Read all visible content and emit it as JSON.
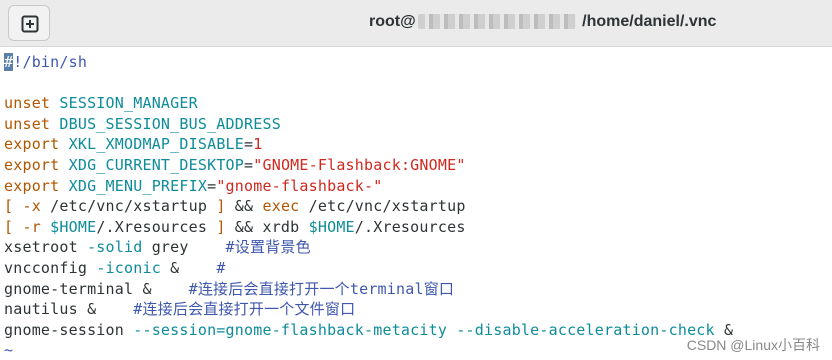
{
  "titlebar": {
    "new_tab_icon": "new-tab-icon",
    "title_prefix": "root@",
    "title_suffix": " /home/daniel/.vnc"
  },
  "colors": {
    "keyword": "#0e8c9a",
    "builtin": "#b25600",
    "string": "#d0281e",
    "comment": "#3f58ae",
    "text": "#2e3436",
    "cursor": "#5a7fa8"
  },
  "editor": {
    "lines": [
      [
        {
          "t": "#",
          "c": "cursor"
        },
        {
          "t": "!/bin/sh",
          "c": "cmt-blue"
        }
      ],
      [],
      [
        {
          "t": "unset",
          "c": "kw-brown"
        },
        {
          "t": " SESSION_MANAGER",
          "c": "kw-cyan"
        }
      ],
      [
        {
          "t": "unset",
          "c": "kw-brown"
        },
        {
          "t": " DBUS_SESSION_BUS_ADDRESS",
          "c": "kw-cyan"
        }
      ],
      [
        {
          "t": "export",
          "c": "kw-brown"
        },
        {
          "t": " XKL_XMODMAP_DISABLE",
          "c": "kw-cyan"
        },
        {
          "t": "=",
          "c": "plain"
        },
        {
          "t": "1",
          "c": "str-red"
        }
      ],
      [
        {
          "t": "export",
          "c": "kw-brown"
        },
        {
          "t": " XDG_CURRENT_DESKTOP",
          "c": "kw-cyan"
        },
        {
          "t": "=",
          "c": "plain"
        },
        {
          "t": "\"GNOME-Flashback:GNOME\"",
          "c": "str-red"
        }
      ],
      [
        {
          "t": "export",
          "c": "kw-brown"
        },
        {
          "t": " XDG_MENU_PREFIX",
          "c": "kw-cyan"
        },
        {
          "t": "=",
          "c": "plain"
        },
        {
          "t": "\"gnome-flashback-\"",
          "c": "str-red"
        }
      ],
      [
        {
          "t": "[ -x ",
          "c": "kw-brown"
        },
        {
          "t": "/etc/vnc/xstartup ",
          "c": "plain"
        },
        {
          "t": "]",
          "c": "kw-brown"
        },
        {
          "t": " && ",
          "c": "plain"
        },
        {
          "t": "exec",
          "c": "kw-brown"
        },
        {
          "t": " /etc/vnc/xstartup",
          "c": "plain"
        }
      ],
      [
        {
          "t": "[ -r ",
          "c": "kw-brown"
        },
        {
          "t": "$HOME",
          "c": "kw-cyan"
        },
        {
          "t": "/.Xresources ",
          "c": "plain"
        },
        {
          "t": "]",
          "c": "kw-brown"
        },
        {
          "t": " && xrdb ",
          "c": "plain"
        },
        {
          "t": "$HOME",
          "c": "kw-cyan"
        },
        {
          "t": "/.Xresources",
          "c": "plain"
        }
      ],
      [
        {
          "t": "xsetroot ",
          "c": "plain"
        },
        {
          "t": "-solid",
          "c": "kw-cyan"
        },
        {
          "t": " grey    ",
          "c": "plain"
        },
        {
          "t": "#设置背景色",
          "c": "cmt-blue"
        }
      ],
      [
        {
          "t": "vncconfig ",
          "c": "plain"
        },
        {
          "t": "-iconic",
          "c": "kw-cyan"
        },
        {
          "t": " &    ",
          "c": "plain"
        },
        {
          "t": "#",
          "c": "cmt-blue"
        }
      ],
      [
        {
          "t": "gnome-terminal &    ",
          "c": "plain"
        },
        {
          "t": "#连接后会直接打开一个terminal窗口",
          "c": "cmt-blue"
        }
      ],
      [
        {
          "t": "nautilus &    ",
          "c": "plain"
        },
        {
          "t": "#连接后会直接打开一个文件窗口",
          "c": "cmt-blue"
        }
      ],
      [
        {
          "t": "gnome-session ",
          "c": "plain"
        },
        {
          "t": "--session=gnome-flashback-metacity --disable-acceleration-check",
          "c": "kw-cyan"
        },
        {
          "t": " &",
          "c": "plain"
        }
      ],
      [
        {
          "t": "~",
          "c": "tilde"
        }
      ]
    ]
  },
  "watermark": "CSDN @Linux小百科"
}
